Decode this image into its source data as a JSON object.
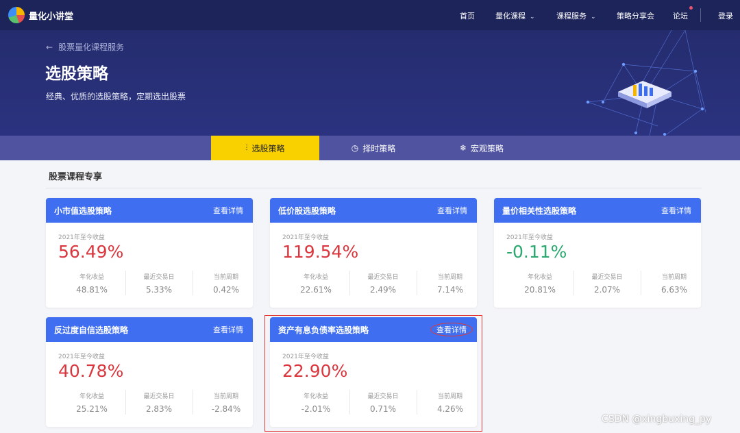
{
  "nav": {
    "brand": "量化小讲堂",
    "items": [
      {
        "label": "首页",
        "dropdown": false
      },
      {
        "label": "量化课程",
        "dropdown": true
      },
      {
        "label": "课程服务",
        "dropdown": true
      },
      {
        "label": "策略分享会",
        "dropdown": false
      },
      {
        "label": "论坛",
        "dropdown": false
      }
    ],
    "login": "登录",
    "chevron": "⌄"
  },
  "hero": {
    "breadcrumb_arrow": "←",
    "breadcrumb": "股票量化课程服务",
    "title": "选股策略",
    "subtitle": "经典、优质的选股策略，定期选出股票"
  },
  "tabs": [
    {
      "label": "选股策略",
      "icon": "candlestick-icon",
      "glyph": "⫶",
      "active": true
    },
    {
      "label": "择时策略",
      "icon": "clock-icon",
      "glyph": "◷",
      "active": false
    },
    {
      "label": "宏观策略",
      "icon": "snowflake-icon",
      "glyph": "❄",
      "active": false
    }
  ],
  "section": {
    "title": "股票课程专享"
  },
  "cards": [
    {
      "name": "小市值选股策略",
      "link": "查看详情",
      "ytd_label": "2021年至今收益",
      "ytd": "56.49%",
      "sign": "pos",
      "stats": [
        {
          "label": "年化收益",
          "value": "48.81%"
        },
        {
          "label": "最近交易日",
          "value": "5.33%"
        },
        {
          "label": "当前周期",
          "value": "0.42%"
        }
      ]
    },
    {
      "name": "低价股选股策略",
      "link": "查看详情",
      "ytd_label": "2021年至今收益",
      "ytd": "119.54%",
      "sign": "pos",
      "stats": [
        {
          "label": "年化收益",
          "value": "22.61%"
        },
        {
          "label": "最近交易日",
          "value": "2.49%"
        },
        {
          "label": "当前周期",
          "value": "7.14%"
        }
      ]
    },
    {
      "name": "量价相关性选股策略",
      "link": "查看详情",
      "ytd_label": "2021年至今收益",
      "ytd": "-0.11%",
      "sign": "neg",
      "stats": [
        {
          "label": "年化收益",
          "value": "20.81%"
        },
        {
          "label": "最近交易日",
          "value": "2.07%"
        },
        {
          "label": "当前周期",
          "value": "6.63%"
        }
      ]
    },
    {
      "name": "反过度自信选股策略",
      "link": "查看详情",
      "ytd_label": "2021年至今收益",
      "ytd": "40.78%",
      "sign": "pos",
      "stats": [
        {
          "label": "年化收益",
          "value": "25.21%"
        },
        {
          "label": "最近交易日",
          "value": "2.83%"
        },
        {
          "label": "当前周期",
          "value": "-2.84%"
        }
      ]
    },
    {
      "name": "资产有息负债率选股策略",
      "link": "查看详情",
      "ytd_label": "2021年至今收益",
      "ytd": "22.90%",
      "sign": "pos",
      "stats": [
        {
          "label": "年化收益",
          "value": "-2.01%"
        },
        {
          "label": "最近交易日",
          "value": "0.71%"
        },
        {
          "label": "当前周期",
          "value": "4.26%"
        }
      ]
    }
  ],
  "watermark": "CSDN @xingbuxing_py",
  "colors": {
    "nav_bg": "#1d2459",
    "accent_tab": "#f9d100",
    "card_head": "#3f6ff0",
    "positive": "#d9363e",
    "negative": "#2aa86f"
  }
}
